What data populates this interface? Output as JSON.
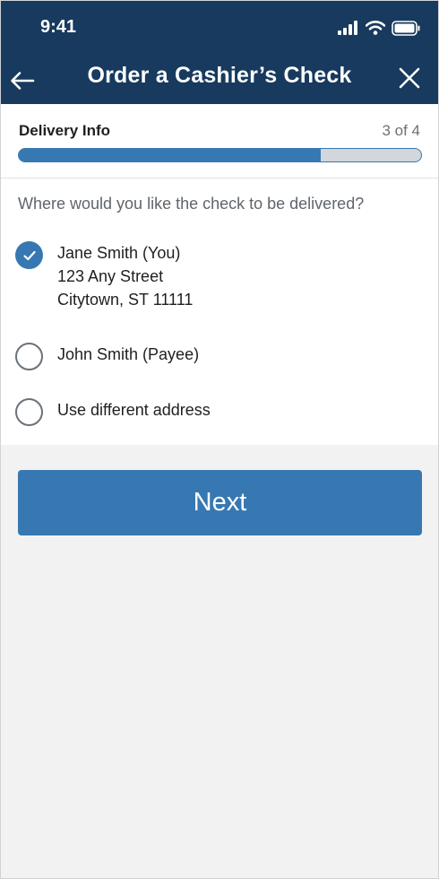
{
  "status_bar": {
    "time": "9:41",
    "icons": [
      "signal-icon",
      "wifi-icon",
      "battery-icon"
    ]
  },
  "header": {
    "title": "Order a Cashier’s Check",
    "back_icon": "arrow-left-icon",
    "close_icon": "close-icon"
  },
  "progress": {
    "label": "Delivery Info",
    "step_text": "3 of 4",
    "fraction": 0.75
  },
  "delivery": {
    "question": "Where would you like the check to be delivered?",
    "options": [
      {
        "lines": [
          "Jane Smith (You)",
          "123 Any Street",
          "Citytown, ST 11111"
        ],
        "selected": true
      },
      {
        "lines": [
          "John Smith (Payee)"
        ],
        "selected": false
      },
      {
        "lines": [
          "Use different address"
        ],
        "selected": false
      }
    ]
  },
  "actions": {
    "next_label": "Next"
  },
  "colors": {
    "header_bg": "#173a5e",
    "accent": "#3778b2",
    "progress_track": "#d3d7db",
    "page_bg": "#f2f2f2"
  }
}
